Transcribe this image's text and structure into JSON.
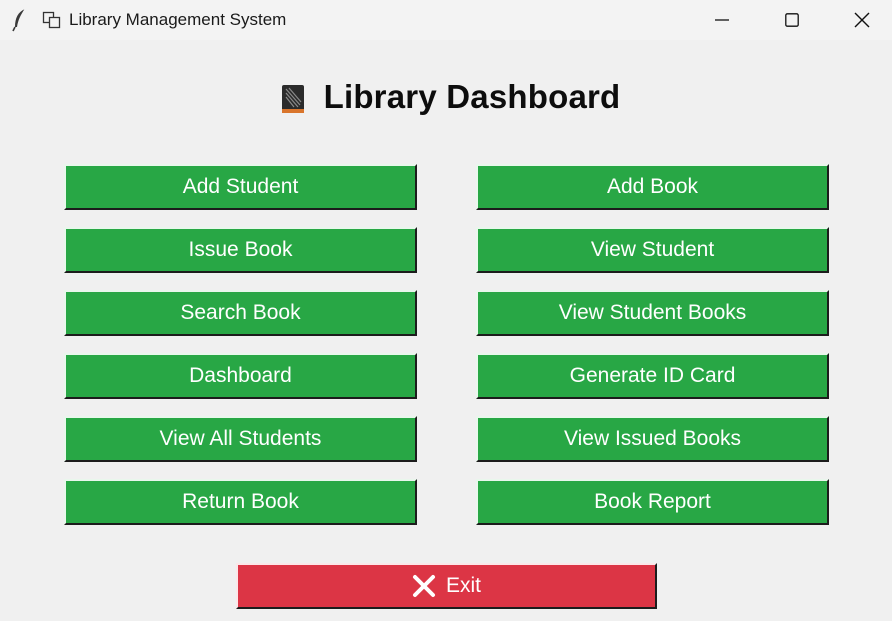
{
  "window": {
    "title": "Library Management System",
    "icons": {
      "app": "feather-icon",
      "window_menu": "window-copy-icon",
      "minimize": "minimize-icon",
      "maximize": "maximize-icon",
      "close": "close-icon"
    }
  },
  "heading": {
    "icon": "book-icon",
    "text": "Library Dashboard"
  },
  "buttons": {
    "left": [
      "Add Student",
      "Issue Book",
      "Search Book",
      "Dashboard",
      "View All Students",
      "Return Book"
    ],
    "right": [
      "Add Book",
      "View Student",
      "View Student Books",
      "Generate ID Card",
      "View Issued Books",
      "Book Report"
    ]
  },
  "exit": {
    "icon": "cross-mark-icon",
    "label": "Exit"
  },
  "colors": {
    "background": "#f0f0f0",
    "button_green": "#28a745",
    "button_red": "#dc3545",
    "button_text": "#ffffff"
  }
}
